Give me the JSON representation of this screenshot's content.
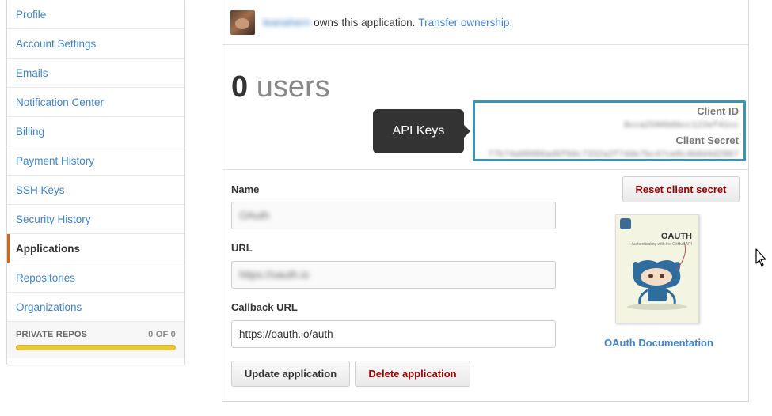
{
  "sidebar": {
    "items": [
      {
        "label": "Profile",
        "selected": false
      },
      {
        "label": "Account Settings",
        "selected": false
      },
      {
        "label": "Emails",
        "selected": false
      },
      {
        "label": "Notification Center",
        "selected": false
      },
      {
        "label": "Billing",
        "selected": false
      },
      {
        "label": "Payment History",
        "selected": false
      },
      {
        "label": "SSH Keys",
        "selected": false
      },
      {
        "label": "Security History",
        "selected": false
      },
      {
        "label": "Applications",
        "selected": true
      },
      {
        "label": "Repositories",
        "selected": false
      },
      {
        "label": "Organizations",
        "selected": false
      }
    ],
    "private_repos": {
      "label": "PRIVATE REPOS",
      "count": "0 OF 0"
    }
  },
  "app": {
    "owner_name": "leanahern",
    "owner_text": "owns this application.",
    "transfer_link": "Transfer ownership.",
    "users_count": "0",
    "users_label": "users",
    "tooltip": "API Keys",
    "client_id_label": "Client ID",
    "client_id_value": "8cca2596b6bcc122ef41cc",
    "client_secret_label": "Client Secret",
    "client_secret_value": "77b74a08086ad6f60c7332a2f7dde7bc47ce8c4b0d4d2867",
    "reset_button": "Reset client secret"
  },
  "form": {
    "name_label": "Name",
    "name_value": "OAuth",
    "url_label": "URL",
    "url_value": "https://oauth.io",
    "callback_label": "Callback URL",
    "callback_value": "https://oauth.io/auth",
    "update_button": "Update application",
    "delete_button": "Delete application"
  },
  "doc": {
    "book_title": "OAUTH",
    "book_subtitle": "Authenticating with the GitHub API",
    "link": "OAuth Documentation"
  },
  "colors": {
    "accent": "#4183c4",
    "danger": "#990000",
    "highlight_box": "#3c93b8",
    "repo_bar": "#e8c93a"
  }
}
